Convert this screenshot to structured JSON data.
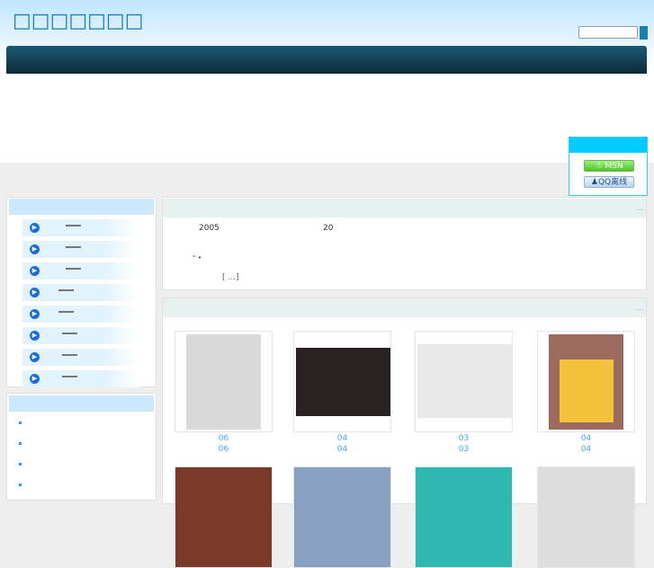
{
  "header": {
    "title": "□□□□□□□",
    "search": {
      "value": "",
      "placeholder": ""
    }
  },
  "contact": {
    "msn_label": "MSN",
    "qq_label": "QQ离线"
  },
  "intro": {
    "more": "...",
    "year": "2005",
    "num": "20",
    "punct": "“  •",
    "readmore": "[ ...]"
  },
  "products": {
    "more": "...",
    "items": [
      {
        "label1": "06",
        "label2": "06",
        "color": "#d9d9d9"
      },
      {
        "label1": "04",
        "label2": "04",
        "color": "#2a2222"
      },
      {
        "label1": "03",
        "label2": "03",
        "color": "#e8e8e8"
      },
      {
        "label1": "04",
        "label2": "04",
        "color": "#9c6a5e"
      }
    ]
  },
  "sidebar": {
    "items": 8,
    "bullets": 4
  }
}
